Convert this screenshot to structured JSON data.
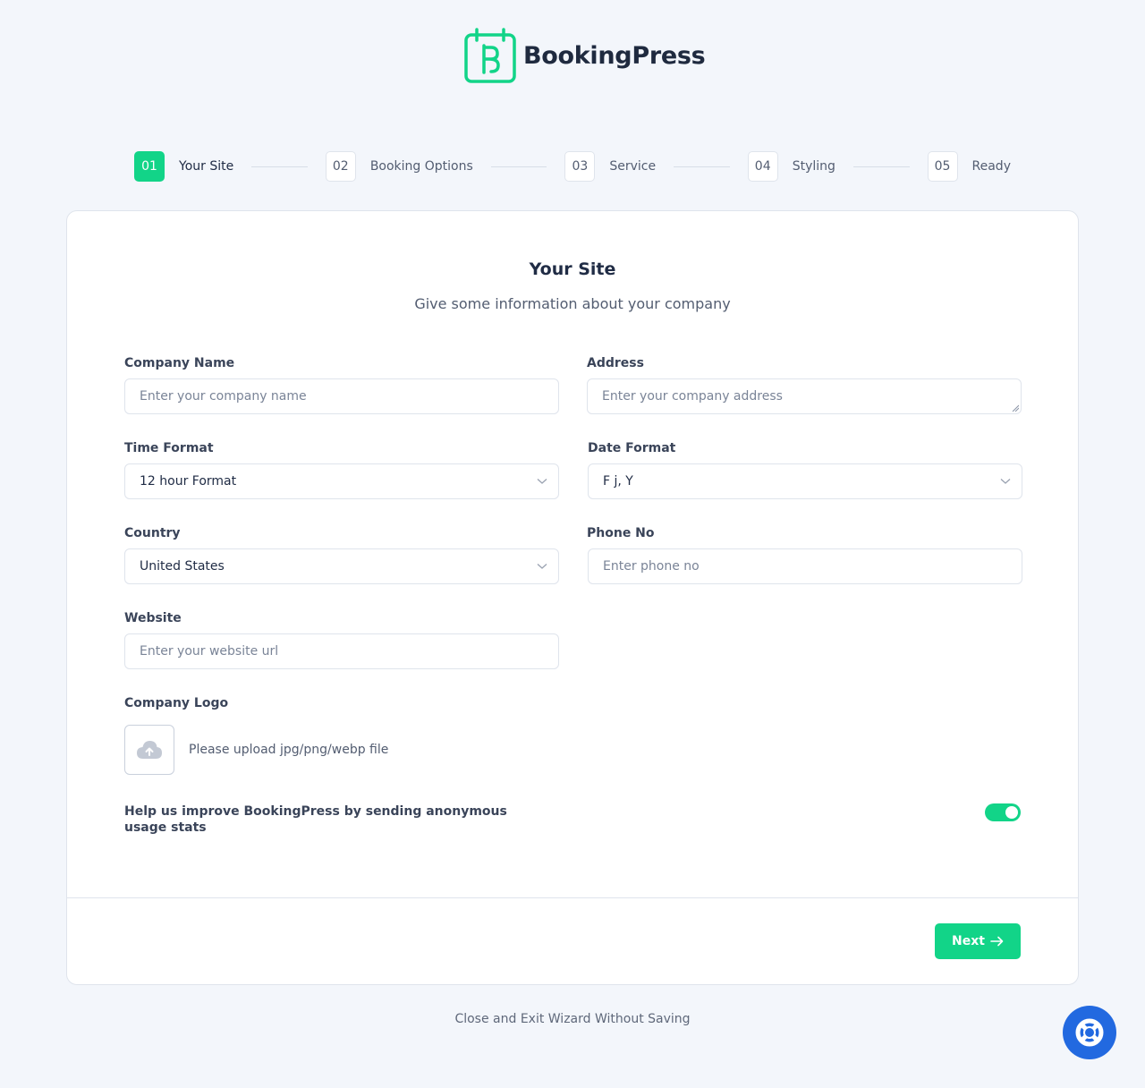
{
  "brand": {
    "name": "BookingPress",
    "accent": "#12d488"
  },
  "stepper": {
    "steps": [
      {
        "num": "01",
        "label": "Your Site",
        "active": true
      },
      {
        "num": "02",
        "label": "Booking Options",
        "active": false
      },
      {
        "num": "03",
        "label": "Service",
        "active": false
      },
      {
        "num": "04",
        "label": "Styling",
        "active": false
      },
      {
        "num": "05",
        "label": "Ready",
        "active": false
      }
    ]
  },
  "form": {
    "title": "Your Site",
    "subtitle": "Give some information about your company",
    "company_name": {
      "label": "Company Name",
      "placeholder": "Enter your company name"
    },
    "address": {
      "label": "Address",
      "placeholder": "Enter your company address"
    },
    "time_format": {
      "label": "Time Format",
      "value": "12 hour Format"
    },
    "date_format": {
      "label": "Date Format",
      "value": "F j, Y"
    },
    "country": {
      "label": "Country",
      "value": "United States"
    },
    "phone": {
      "label": "Phone No",
      "placeholder": "Enter phone no"
    },
    "website": {
      "label": "Website",
      "placeholder": "Enter your website url"
    },
    "logo": {
      "label": "Company Logo",
      "hint": "Please upload jpg/png/webp file",
      "icon": "cloud-upload-icon"
    },
    "usage_stats": {
      "label": "Help us improve BookingPress by sending anonymous usage stats",
      "enabled": true
    }
  },
  "footer": {
    "next_label": "Next",
    "exit_label": "Close and Exit Wizard Without Saving"
  },
  "help": {
    "icon": "lifebuoy-icon",
    "color": "#2269e0"
  }
}
